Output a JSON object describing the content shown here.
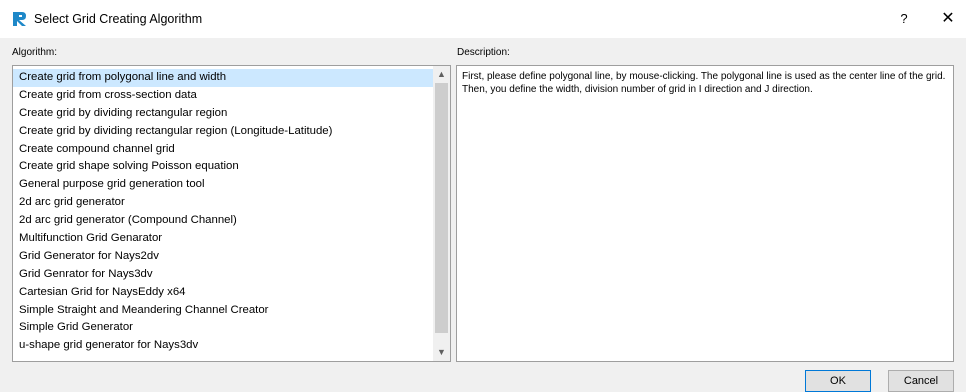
{
  "window": {
    "title": "Select Grid Creating Algorithm",
    "help_label": "?",
    "close_label": "✕",
    "icon": "app-logo-icon"
  },
  "algorithm": {
    "label": "Algorithm:",
    "selected_index": 0,
    "items": [
      "Create grid from polygonal line and width",
      "Create grid from cross-section data",
      "Create grid by dividing rectangular region",
      "Create grid by dividing rectangular region (Longitude-Latitude)",
      "Create compound channel grid",
      "Create grid shape solving Poisson equation",
      "General purpose grid generation tool",
      "2d arc grid generator",
      "2d arc grid generator (Compound Channel)",
      "Multifunction Grid Genarator",
      "Grid Generator for Nays2dv",
      "Grid Genrator for Nays3dv",
      "Cartesian Grid for NaysEddy x64",
      "Simple Straight and Meandering Channel Creator",
      "Simple Grid Generator",
      "u-shape grid generator for Nays3dv"
    ]
  },
  "description": {
    "label": "Description:",
    "text": "First, please define polygonal line, by mouse-clicking. The polygonal line is used as the center line of the grid. Then, you define the width, division number of grid in I direction and J direction."
  },
  "buttons": {
    "ok": "OK",
    "cancel": "Cancel"
  },
  "colors": {
    "selection": "#cce8ff",
    "accent": "#0078d7",
    "logo_blue": "#1e88c8"
  }
}
